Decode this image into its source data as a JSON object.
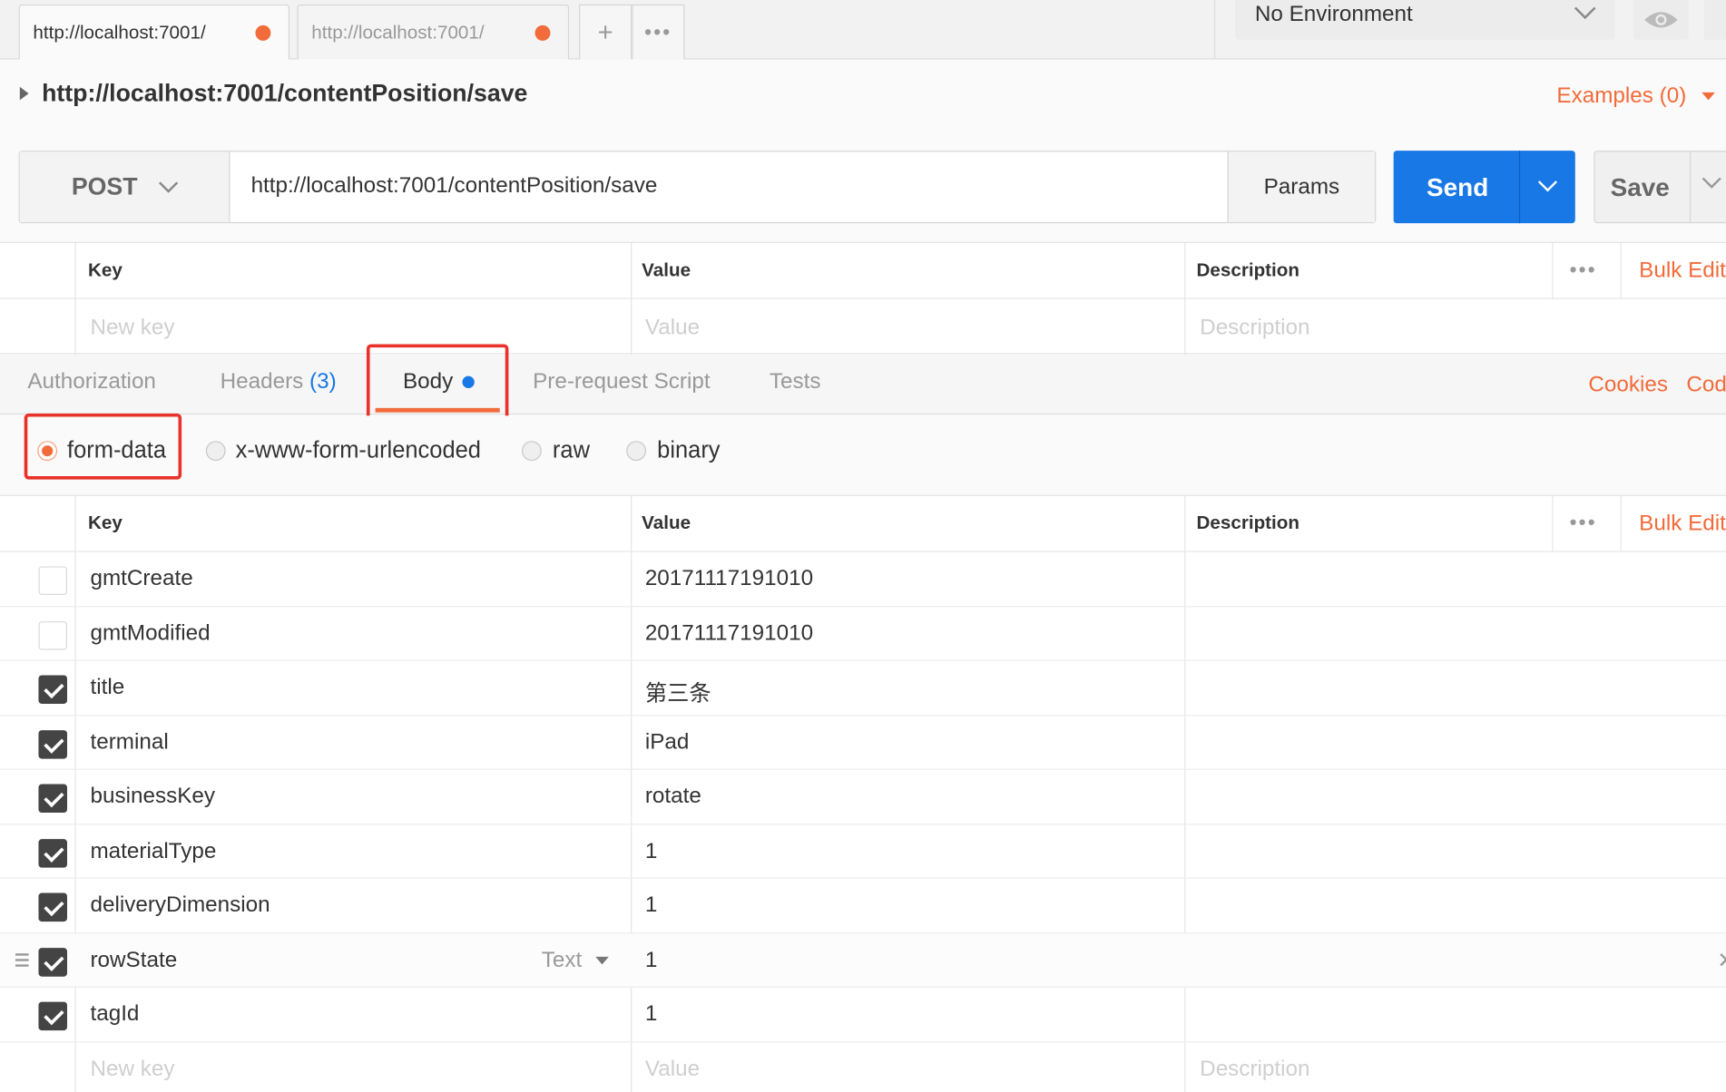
{
  "tabs": [
    {
      "label": "http://localhost:7001/",
      "active": true
    },
    {
      "label": "http://localhost:7001/",
      "active": false
    }
  ],
  "tab_actions": {
    "add_icon": "plus",
    "more_icon": "ellipsis"
  },
  "environment": {
    "selected": "No Environment"
  },
  "request": {
    "name": "http://localhost:7001/contentPosition/save",
    "examples_label": "Examples (0)",
    "method": "POST",
    "url": "http://localhost:7001/contentPosition/save",
    "params_label": "Params",
    "send_label": "Send",
    "save_label": "Save"
  },
  "params_table": {
    "headers": {
      "key": "Key",
      "value": "Value",
      "description": "Description"
    },
    "bulk_edit": "Bulk Edit",
    "placeholders": {
      "key": "New key",
      "value": "Value",
      "description": "Description"
    }
  },
  "subtabs": {
    "authorization": "Authorization",
    "headers": "Headers",
    "headers_count": "(3)",
    "body": "Body",
    "prerequest": "Pre-request Script",
    "tests": "Tests",
    "cookies": "Cookies",
    "code": "Code"
  },
  "body_types": [
    {
      "label": "form-data",
      "selected": true
    },
    {
      "label": "x-www-form-urlencoded",
      "selected": false
    },
    {
      "label": "raw",
      "selected": false
    },
    {
      "label": "binary",
      "selected": false
    }
  ],
  "body_table": {
    "headers": {
      "key": "Key",
      "value": "Value",
      "description": "Description"
    },
    "bulk_edit": "Bulk Edit",
    "type_label": "Text",
    "rows": [
      {
        "key": "gmtCreate",
        "value": "20171117191010",
        "checked": false
      },
      {
        "key": "gmtModified",
        "value": "20171117191010",
        "checked": false
      },
      {
        "key": "title",
        "value": "第三条",
        "checked": true
      },
      {
        "key": "terminal",
        "value": "iPad",
        "checked": true
      },
      {
        "key": "businessKey",
        "value": "rotate",
        "checked": true
      },
      {
        "key": "materialType",
        "value": "1",
        "checked": true
      },
      {
        "key": "deliveryDimension",
        "value": "1",
        "checked": true
      },
      {
        "key": "rowState",
        "value": "1",
        "checked": true
      },
      {
        "key": "tagId",
        "value": "1",
        "checked": true
      }
    ],
    "placeholders": {
      "key": "New key",
      "value": "Value",
      "description": "Description"
    }
  },
  "colors": {
    "accent": "#f26b3a",
    "primary": "#1878e6",
    "highlight": "#e8322b"
  }
}
